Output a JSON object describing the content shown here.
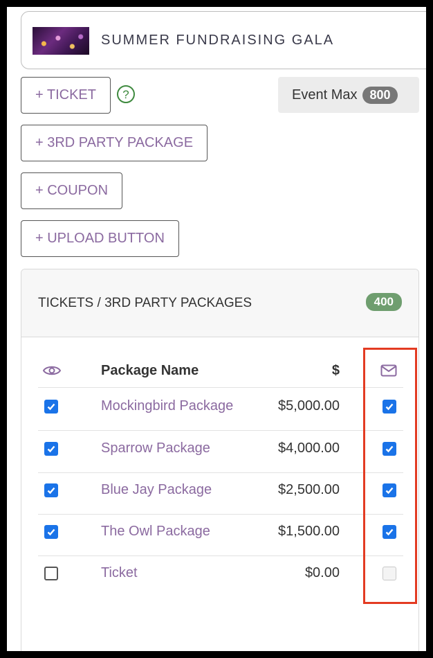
{
  "event": {
    "title": "SUMMER FUNDRAISING GALA"
  },
  "actions": {
    "ticket": "+ TICKET",
    "third_party": "+ 3RD PARTY PACKAGE",
    "coupon": "+ COUPON",
    "upload": "+ UPLOAD BUTTON"
  },
  "event_max": {
    "label": "Event Max",
    "value": "800"
  },
  "panel": {
    "title": "TICKETS / 3RD PARTY PACKAGES",
    "count": "400",
    "columns": {
      "visibility_icon": "eye-icon",
      "name": "Package Name",
      "price": "$",
      "email_icon": "envelope-icon"
    },
    "rows": [
      {
        "name": "Mockingbird Package",
        "price": "$5,000.00",
        "visible": true,
        "email": true
      },
      {
        "name": "Sparrow Package",
        "price": "$4,000.00",
        "visible": true,
        "email": true
      },
      {
        "name": "Blue Jay Package",
        "price": "$2,500.00",
        "visible": true,
        "email": true
      },
      {
        "name": "The Owl Package",
        "price": "$1,500.00",
        "visible": true,
        "email": true
      },
      {
        "name": "Ticket",
        "price": "$0.00",
        "visible": false,
        "email": false,
        "email_disabled": true
      }
    ]
  },
  "colors": {
    "accent": "#8b6aa0",
    "checkbox": "#1a73e8",
    "badge_green": "#6f9e6f",
    "highlight": "#e33b22"
  }
}
